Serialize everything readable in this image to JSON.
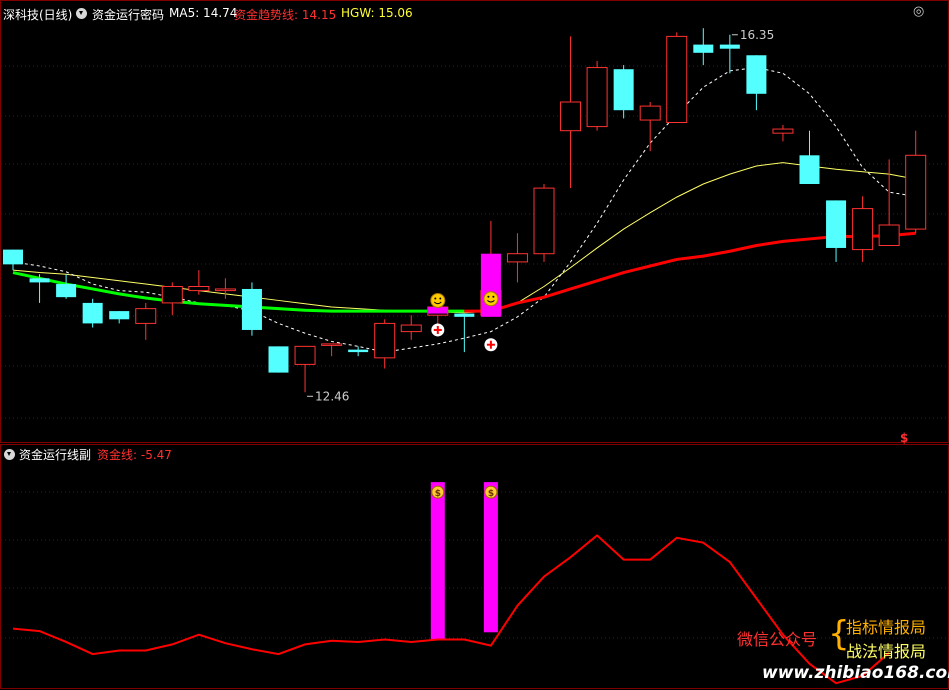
{
  "header": {
    "ticker": "深科技(日线)",
    "indicator": "资金运行密码",
    "ma5_label": "MA5: 14.74",
    "trend_label": "资金趋势线: 14.15",
    "hgw_label": "HGW: 15.06",
    "dollar_mark": "$"
  },
  "sub_header": {
    "indicator": "资金运行线副",
    "capital_label": "资金线: -5.47"
  },
  "watermark": {
    "wechat": "微信公众号",
    "brace": "{",
    "line1": "指标情报局",
    "line2": "战法情报局",
    "site": "www.zhibiao168.com"
  },
  "colors": {
    "up": "#ff3232",
    "down": "#54ffff",
    "trend_green": "#00ff00",
    "trend_red": "#ff0000",
    "ma5": "#ffffff",
    "hgw": "#ffff66",
    "signal": "#ff00ff",
    "grid": "#800000",
    "capital_line": "#ff0000"
  },
  "chart_data": [
    {
      "type": "candlestick",
      "title": "资金运行密码",
      "annotations": [
        {
          "label": "16.35",
          "candle_index": 27,
          "kind": "high"
        },
        {
          "label": "12.46",
          "candle_index": 11,
          "kind": "low"
        }
      ],
      "ylim": [
        12.0,
        17.0
      ],
      "candles": [
        {
          "o": 14.2,
          "h": 14.2,
          "l": 13.95,
          "c": 14.02
        },
        {
          "o": 13.85,
          "h": 13.9,
          "l": 13.55,
          "c": 13.8
        },
        {
          "o": 13.78,
          "h": 13.9,
          "l": 13.6,
          "c": 13.62
        },
        {
          "o": 13.55,
          "h": 13.6,
          "l": 13.25,
          "c": 13.3
        },
        {
          "o": 13.45,
          "h": 13.45,
          "l": 13.3,
          "c": 13.35
        },
        {
          "o": 13.3,
          "h": 13.55,
          "l": 13.1,
          "c": 13.48
        },
        {
          "o": 13.55,
          "h": 13.8,
          "l": 13.4,
          "c": 13.75
        },
        {
          "o": 13.7,
          "h": 13.95,
          "l": 13.65,
          "c": 13.75
        },
        {
          "o": 13.7,
          "h": 13.85,
          "l": 13.6,
          "c": 13.72
        },
        {
          "o": 13.72,
          "h": 13.8,
          "l": 13.15,
          "c": 13.22
        },
        {
          "o": 13.02,
          "h": 13.02,
          "l": 12.7,
          "c": 12.7
        },
        {
          "o": 12.8,
          "h": 13.02,
          "l": 12.46,
          "c": 13.02
        },
        {
          "o": 13.05,
          "h": 13.05,
          "l": 12.9,
          "c": 13.05
        },
        {
          "o": 12.98,
          "h": 13.02,
          "l": 12.9,
          "c": 12.95
        },
        {
          "o": 12.88,
          "h": 13.35,
          "l": 12.75,
          "c": 13.3
        },
        {
          "o": 13.2,
          "h": 13.4,
          "l": 13.1,
          "c": 13.28
        },
        {
          "o": 13.4,
          "h": 13.6,
          "l": 13.25,
          "c": 13.5
        },
        {
          "o": 13.42,
          "h": 13.42,
          "l": 12.95,
          "c": 13.38
        },
        {
          "o": 13.4,
          "h": 14.55,
          "l": 13.4,
          "c": 13.7
        },
        {
          "o": 14.05,
          "h": 14.4,
          "l": 13.8,
          "c": 14.15
        },
        {
          "o": 14.15,
          "h": 15.0,
          "l": 14.05,
          "c": 14.95
        },
        {
          "o": 15.65,
          "h": 16.8,
          "l": 14.95,
          "c": 16.0
        },
        {
          "o": 15.7,
          "h": 16.5,
          "l": 15.65,
          "c": 16.42
        },
        {
          "o": 16.4,
          "h": 16.45,
          "l": 15.8,
          "c": 15.9
        },
        {
          "o": 15.78,
          "h": 16.0,
          "l": 15.4,
          "c": 15.95
        },
        {
          "o": 15.75,
          "h": 16.85,
          "l": 15.75,
          "c": 16.8
        },
        {
          "o": 16.7,
          "h": 16.9,
          "l": 16.45,
          "c": 16.6
        },
        {
          "o": 16.7,
          "h": 16.82,
          "l": 16.35,
          "c": 16.65
        },
        {
          "o": 16.57,
          "h": 16.57,
          "l": 15.9,
          "c": 16.1
        },
        {
          "o": 15.62,
          "h": 15.72,
          "l": 15.52,
          "c": 15.67
        },
        {
          "o": 15.35,
          "h": 15.65,
          "l": 15.1,
          "c": 15.0
        },
        {
          "o": 14.8,
          "h": 14.8,
          "l": 14.05,
          "c": 14.22
        },
        {
          "o": 14.2,
          "h": 14.85,
          "l": 14.05,
          "c": 14.7
        },
        {
          "o": 14.25,
          "h": 15.3,
          "l": 14.25,
          "c": 14.5
        },
        {
          "o": 14.45,
          "h": 15.65,
          "l": 14.4,
          "c": 15.35
        }
      ],
      "ma5": [
        14.05,
        14.0,
        13.93,
        13.78,
        13.7,
        13.68,
        13.62,
        13.55,
        13.52,
        13.45,
        13.3,
        13.18,
        13.08,
        13.02,
        12.95,
        13.0,
        13.05,
        13.12,
        13.2,
        13.38,
        13.62,
        14.05,
        14.52,
        15.05,
        15.5,
        15.85,
        16.18,
        16.38,
        16.42,
        16.35,
        16.1,
        15.7,
        15.2,
        14.9,
        14.85
      ],
      "hgw": [
        13.95,
        13.92,
        13.9,
        13.86,
        13.82,
        13.78,
        13.74,
        13.7,
        13.66,
        13.62,
        13.58,
        13.54,
        13.5,
        13.48,
        13.46,
        13.45,
        13.44,
        13.43,
        13.45,
        13.55,
        13.75,
        13.98,
        14.22,
        14.45,
        14.65,
        14.84,
        15.0,
        15.12,
        15.22,
        15.26,
        15.22,
        15.18,
        15.15,
        15.12,
        15.06
      ],
      "trend": [
        13.92,
        13.85,
        13.78,
        13.72,
        13.66,
        13.61,
        13.57,
        13.54,
        13.52,
        13.5,
        13.48,
        13.46,
        13.45,
        13.45,
        13.45,
        13.45,
        13.45,
        13.45,
        13.45,
        13.55,
        13.62,
        13.72,
        13.82,
        13.92,
        14.0,
        14.08,
        14.12,
        14.18,
        14.25,
        14.3,
        14.33,
        14.36,
        14.36,
        14.37,
        14.4
      ],
      "trend_green_until_index": 17,
      "smiley_indices": [
        16,
        18
      ],
      "plus_indices": [
        16,
        18
      ]
    },
    {
      "type": "line",
      "title": "资金运行线副",
      "series": [
        {
          "name": "资金线",
          "values": [
            4.5,
            3.5,
            -1.0,
            -6.0,
            -4.5,
            -4.5,
            -2.0,
            2.0,
            -1.5,
            -4.0,
            -6.0,
            -2.0,
            -0.5,
            -1.0,
            0.0,
            -1.0,
            0.0,
            0.0,
            -2.5,
            14.0,
            26.0,
            34.0,
            43.0,
            33.0,
            33.0,
            42.0,
            40.0,
            32.0,
            17.0,
            2.0,
            -10.0,
            -18.0,
            -15.0,
            -5.47
          ]
        }
      ],
      "ylim": [
        -20,
        70
      ],
      "signal_bars": [
        {
          "index": 16,
          "top": 65,
          "bottom": 0
        },
        {
          "index": 18,
          "top": 65,
          "bottom": 3
        }
      ]
    }
  ]
}
